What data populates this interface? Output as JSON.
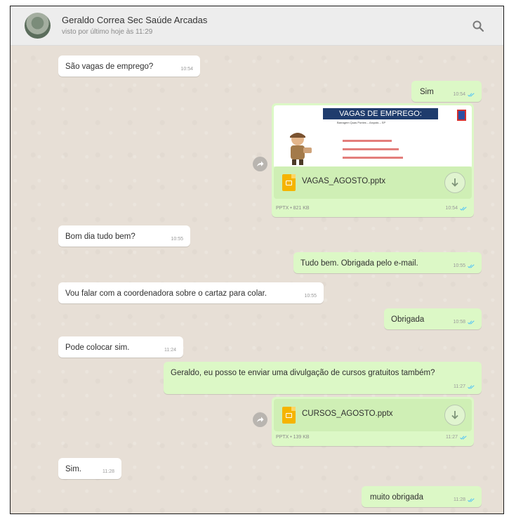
{
  "header": {
    "contact_name": "Geraldo Correa Sec Saúde Arcadas",
    "last_seen": "visto por último hoje às 11:29"
  },
  "messages": [
    {
      "dir": "in",
      "text": "São vagas de emprego?",
      "time": "10:54"
    },
    {
      "dir": "out",
      "text": "Sim",
      "time": "10:54"
    },
    {
      "dir": "in",
      "text": "Bom dia tudo bem?",
      "time": "10:55"
    },
    {
      "dir": "out",
      "text": "Tudo bem. Obrigada pelo e-mail.",
      "time": "10:55"
    },
    {
      "dir": "in",
      "text": "Vou falar com a coordenadora sobre o cartaz para colar.",
      "time": "10:55"
    },
    {
      "dir": "out",
      "text": "Obrigada",
      "time": "10:58"
    },
    {
      "dir": "in",
      "text": "Pode colocar sim.",
      "time": "11:24"
    },
    {
      "dir": "out",
      "text": "Geraldo, eu posso te enviar uma divulgação de cursos gratuitos também?",
      "time": "11:27"
    },
    {
      "dir": "in",
      "text": "Sim.",
      "time": "11:28"
    },
    {
      "dir": "out",
      "text": "muito obrigada",
      "time": "11:28"
    }
  ],
  "files": [
    {
      "name": "VAGAS_AGOSTO.pptx",
      "meta": "PPTX • 821 KB",
      "time": "10:54",
      "preview_title": "VAGAS DE EMPREGO:",
      "preview_subtitle": "Barragem Quas Pontes – Arcpais – SP"
    },
    {
      "name": "CURSOS_AGOSTO.pptx",
      "meta": "PPTX • 139 KB",
      "time": "11:27"
    }
  ],
  "colors": {
    "incoming_bubble": "#ffffff",
    "outgoing_bubble": "#dcf8c6",
    "read_ticks": "#4fc3f7",
    "chat_background": "#e7dfd6"
  },
  "icons": {
    "search": "magnifier",
    "forward": "share-arrow",
    "download": "down-arrow-circle",
    "read_receipt": "double-check"
  }
}
